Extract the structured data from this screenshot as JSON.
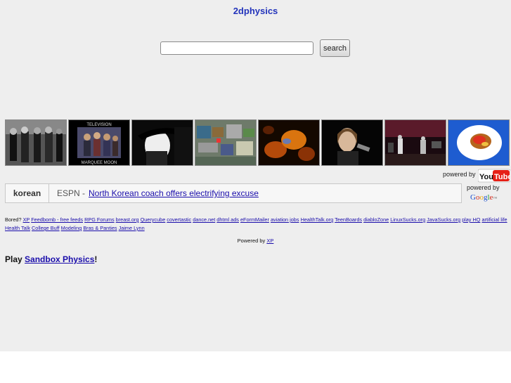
{
  "site": {
    "title": "2dphysics"
  },
  "search": {
    "placeholder": "",
    "value": "",
    "button_label": "search"
  },
  "thumbnails": [
    {
      "name": "band-photo-bw"
    },
    {
      "name": "television-marquee-moon",
      "caption_top": "TELEVISION",
      "caption_bottom": "MARQUEE MOON"
    },
    {
      "name": "hat-portrait-bw"
    },
    {
      "name": "game-screenshot"
    },
    {
      "name": "orange-abstract"
    },
    {
      "name": "singer-microphone"
    },
    {
      "name": "concert-stage"
    },
    {
      "name": "food-plate-blue"
    }
  ],
  "youtube": {
    "powered_label": "powered by",
    "logo_left": "You",
    "logo_right": "Tube"
  },
  "news": {
    "keyword": "korean",
    "source": "ESPN -",
    "headline": "North Korean coach offers electrifying excuse"
  },
  "google": {
    "powered_label": "powered by",
    "logo_text": "Google"
  },
  "links": {
    "intro": "Bored?",
    "items": [
      "XP",
      "Feedbomb - free feeds",
      "RPG Forums",
      "breast.org",
      "Querycube",
      "covertastic",
      "dance.net",
      "dhtml ads",
      "eFormMailer",
      "aviation jobs",
      "HealthTalk.org",
      "TeenBoards",
      "diabloZone",
      "LinuxSucks.org",
      "JavaSucks.org",
      "play HQ",
      "artificial life",
      "Health Talk",
      "College Buff",
      "Modeling",
      "Bras & Panties",
      "Jaime Lynn"
    ]
  },
  "footer": {
    "powered_label": "Powered by",
    "powered_link": "XP"
  },
  "play": {
    "prefix": "Play",
    "link": "Sandbox Physics",
    "suffix": "!"
  },
  "colors": {
    "link": "#1a0dab",
    "title": "#2233bb",
    "page_bg": "#eeeeee"
  }
}
